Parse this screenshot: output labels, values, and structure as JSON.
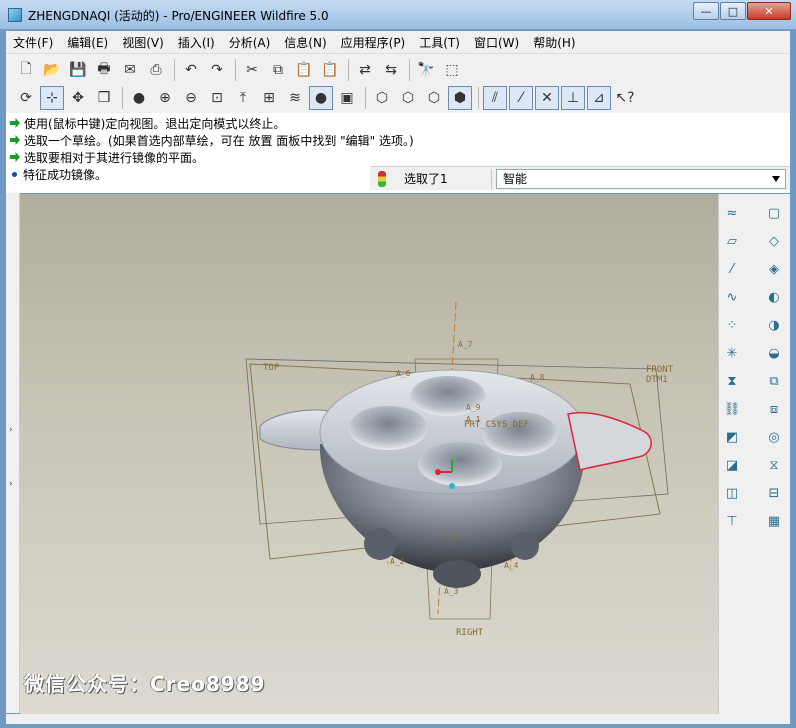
{
  "window": {
    "title": "ZHENGDNAQI (活动的) - Pro/ENGINEER Wildfire 5.0",
    "minimize": "—",
    "maximize": "□",
    "close": "✕"
  },
  "menu": [
    {
      "label": "文件(F)"
    },
    {
      "label": "编辑(E)"
    },
    {
      "label": "视图(V)"
    },
    {
      "label": "插入(I)"
    },
    {
      "label": "分析(A)"
    },
    {
      "label": "信息(N)"
    },
    {
      "label": "应用程序(P)"
    },
    {
      "label": "工具(T)"
    },
    {
      "label": "窗口(W)"
    },
    {
      "label": "帮助(H)"
    }
  ],
  "toolbar_row1": [
    {
      "icon": "new-file-icon",
      "glyph": "🗋"
    },
    {
      "icon": "open-folder-icon",
      "glyph": "📂"
    },
    {
      "icon": "save-icon",
      "glyph": "💾"
    },
    {
      "icon": "print-icon",
      "glyph": "🖶"
    },
    {
      "icon": "send-mail-icon",
      "glyph": "✉"
    },
    {
      "icon": "mail-attach-icon",
      "glyph": "⎙"
    },
    {
      "icon": "undo-icon",
      "glyph": "↶"
    },
    {
      "icon": "redo-icon",
      "glyph": "↷"
    },
    {
      "icon": "cut-icon",
      "glyph": "✂"
    },
    {
      "icon": "copy-icon",
      "glyph": "⧉"
    },
    {
      "icon": "paste-icon",
      "glyph": "📋"
    },
    {
      "icon": "paste-special-icon",
      "glyph": "📋"
    },
    {
      "icon": "regenerate-icon",
      "glyph": "⇄"
    },
    {
      "icon": "regen-manager-icon",
      "glyph": "⇆"
    },
    {
      "icon": "find-icon",
      "glyph": "🔭"
    },
    {
      "icon": "selection-box-icon",
      "glyph": "⬚"
    }
  ],
  "toolbar_row2": [
    {
      "icon": "repaint-icon",
      "glyph": "⟳"
    },
    {
      "icon": "spin-center-icon",
      "glyph": "⊹",
      "active": true
    },
    {
      "icon": "orient-mode-icon",
      "glyph": "✥"
    },
    {
      "icon": "view-manager-icon",
      "glyph": "❒"
    },
    {
      "icon": "appearance-ball-icon",
      "glyph": "●"
    },
    {
      "icon": "zoom-in-icon",
      "glyph": "⊕"
    },
    {
      "icon": "zoom-out-icon",
      "glyph": "⊖"
    },
    {
      "icon": "fit-view-icon",
      "glyph": "⊡"
    },
    {
      "icon": "reorient-icon",
      "glyph": "⤒"
    },
    {
      "icon": "saved-views-icon",
      "glyph": "⊞"
    },
    {
      "icon": "layers-icon",
      "glyph": "≋"
    },
    {
      "icon": "display-style-icon",
      "glyph": "●",
      "active": true
    },
    {
      "icon": "screenshot-icon",
      "glyph": "▣"
    },
    {
      "icon": "wireframe-icon",
      "glyph": "⬡"
    },
    {
      "icon": "hidden-line-icon",
      "glyph": "⬡"
    },
    {
      "icon": "no-hidden-icon",
      "glyph": "⬡"
    },
    {
      "icon": "shading-icon",
      "glyph": "⬢",
      "active": true
    },
    {
      "icon": "datum-planes-icon",
      "glyph": "⫽",
      "active": true
    },
    {
      "icon": "datum-axes-icon",
      "glyph": "⁄",
      "active": true
    },
    {
      "icon": "datum-points-icon",
      "glyph": "✕",
      "active": true
    },
    {
      "icon": "csys-icon",
      "glyph": "⊥",
      "active": true
    },
    {
      "icon": "annotation-icon",
      "glyph": "⊿",
      "active": true
    },
    {
      "icon": "context-help-icon",
      "glyph": "↖?"
    }
  ],
  "messages": [
    {
      "type": "arrow",
      "text": "使用(鼠标中键)定向视图。退出定向模式以终止。"
    },
    {
      "type": "arrow",
      "text": "选取一个草绘。(如果首选内部草绘，可在 放置 面板中找到 \"编辑\" 选项。)"
    },
    {
      "type": "arrow",
      "text": "选取要相对于其进行镜像的平面。"
    },
    {
      "type": "dot",
      "text": "特征成功镜像。"
    }
  ],
  "selection": {
    "status": "选取了1",
    "filter": "智能"
  },
  "viewport": {
    "watermark": "微信公众号：Creo8989",
    "labels": {
      "top": "TOP",
      "front": "FRONT",
      "dtm1": "DTM1",
      "right": "RIGHT",
      "csys": "PRT_CSYS_DEF",
      "a7": "A_7",
      "a6": "A_6",
      "a8": "A_8",
      "a9": "A_9",
      "a1": "A_1",
      "a2": "A_2",
      "a3": "A_3",
      "a4": "A_4",
      "a5": "A_5"
    }
  },
  "right_tools": [
    {
      "icon": "sketch-datum-curve-icon",
      "glyph": "≈"
    },
    {
      "icon": "datum-plane-icon",
      "glyph": "▱"
    },
    {
      "icon": "datum-axis-icon",
      "glyph": "⁄"
    },
    {
      "icon": "datum-curve-icon",
      "glyph": "∿"
    },
    {
      "icon": "datum-point-icon",
      "glyph": "⁘"
    },
    {
      "icon": "csys-tool-icon",
      "glyph": "✳"
    },
    {
      "icon": "analysis-tool-icon",
      "glyph": "⧗"
    },
    {
      "icon": "chain-icon",
      "glyph": "⛓"
    },
    {
      "icon": "edge-round-icon",
      "glyph": "◩"
    },
    {
      "icon": "chamfer-icon",
      "glyph": "◪"
    },
    {
      "icon": "rib-icon",
      "glyph": "◫"
    },
    {
      "icon": "draft-icon",
      "glyph": "⊤"
    },
    {
      "icon": "shell-icon",
      "glyph": "▢"
    },
    {
      "icon": "hole-icon",
      "glyph": "◇"
    },
    {
      "icon": "extrude-icon",
      "glyph": "◈"
    },
    {
      "icon": "revolve-icon",
      "glyph": "◐"
    },
    {
      "icon": "sweep-icon",
      "glyph": "◑"
    },
    {
      "icon": "blend-icon",
      "glyph": "◒"
    },
    {
      "icon": "pattern-icon",
      "glyph": "⧉"
    },
    {
      "icon": "mirror-icon",
      "glyph": "⧈"
    },
    {
      "icon": "merge-icon",
      "glyph": "◎"
    },
    {
      "icon": "trim-icon",
      "glyph": "⧖"
    },
    {
      "icon": "offset-icon",
      "glyph": "⊟"
    },
    {
      "icon": "table-icon",
      "glyph": "▦"
    }
  ]
}
